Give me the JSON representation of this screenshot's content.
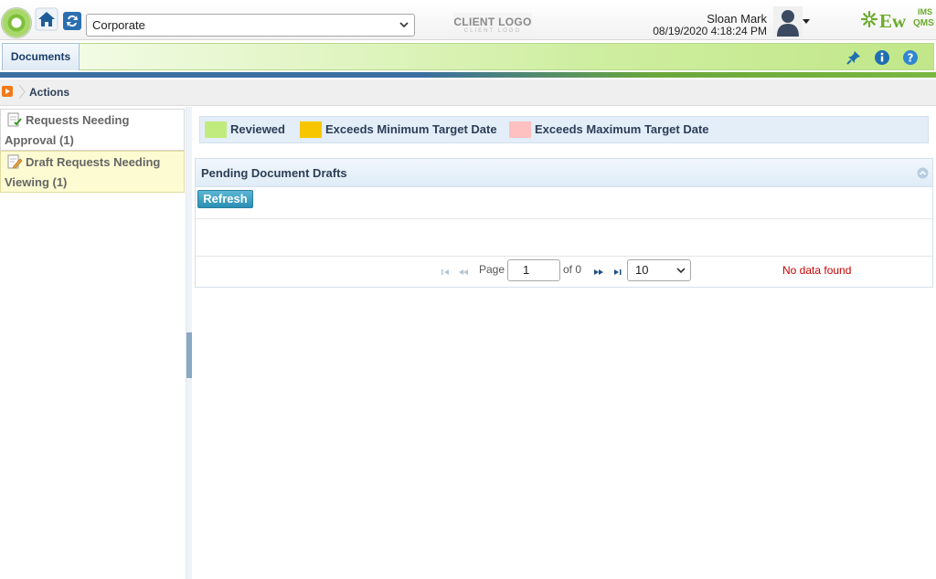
{
  "header": {
    "organization": "Corporate",
    "client_logo": "CLIENT LOGO",
    "client_logo_sub": "CLIENT LOGO",
    "user_name": "Sloan Mark",
    "datetime": "08/19/2020 4:18:24 PM",
    "brand_main": "Ew",
    "brand_ims": "IMS",
    "brand_qms": "QMS",
    "brand_color": "#6bab2b"
  },
  "nav": {
    "tab_label": "Documents",
    "icons": [
      "pin-icon",
      "info-icon",
      "help-icon"
    ]
  },
  "breadcrumb": {
    "label": "Actions"
  },
  "sidebar": {
    "items": [
      {
        "label": "Requests Needing Approval (1)",
        "icon": "approval-document-icon"
      },
      {
        "label": "Draft Requests Needing Viewing (1)",
        "icon": "draft-edit-icon"
      }
    ]
  },
  "legend": {
    "items": [
      {
        "label": "Reviewed",
        "color": "#c1eb7c"
      },
      {
        "label": "Exceeds Minimum Target Date",
        "color": "#f7c600"
      },
      {
        "label": "Exceeds Maximum Target Date",
        "color": "#ffc0c0"
      }
    ]
  },
  "panel": {
    "title": "Pending Document Drafts",
    "refresh_label": "Refresh",
    "pager": {
      "page_label": "Page",
      "page_value": "1",
      "of_label": "of 0",
      "page_size": "10",
      "empty_message": "No data found"
    }
  }
}
